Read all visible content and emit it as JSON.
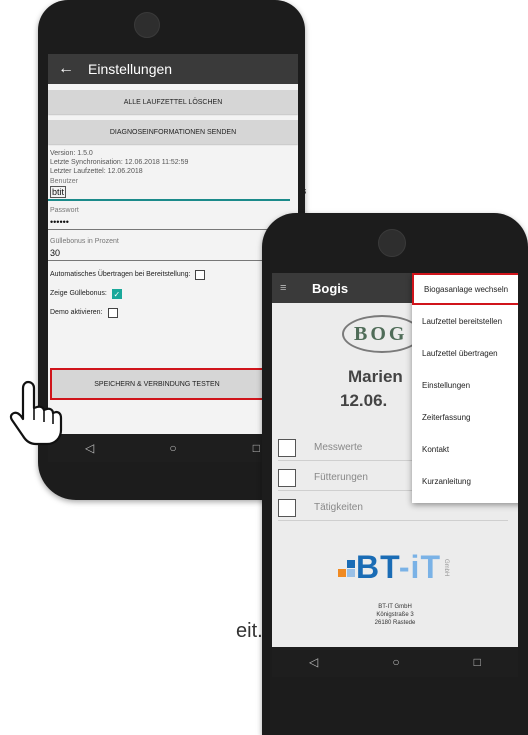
{
  "background_fragments": {
    "quote": "“",
    "tail": "eit."
  },
  "settings_screen": {
    "title": "Einstellungen",
    "btn_delete_all": "ALLE LAUFZETTEL LÖSCHEN",
    "btn_send_diag": "DIAGNOSEINFORMATIONEN SENDEN",
    "info_version": "Version: 1.5.0",
    "info_last_sync": "Letzte Synchronisation: 12.06.2018 11:52:59",
    "info_last_slip": "Letzter Laufzettel: 12.06.2018",
    "user_label": "Benutzer",
    "user_value": "btit",
    "password_label": "Passwort",
    "password_value": "••••••",
    "bonus_label": "Güllebonus in Prozent",
    "bonus_value": "30",
    "auto_transfer_label": "Automatisches Übertragen bei Bereitstellung:",
    "auto_transfer_checked": false,
    "show_bonus_label": "Zeige Güllebonus:",
    "show_bonus_checked": true,
    "demo_label": "Demo aktivieren:",
    "demo_checked": false,
    "save_button": "SPEICHERN & VERBINDUNG TESTEN",
    "accent_color": "#d0141b"
  },
  "home_screen": {
    "title": "Bogis",
    "logo_text": "BOG",
    "site_name": "Marien",
    "site_date": "12.06.",
    "rows": [
      {
        "label": "Messwerte"
      },
      {
        "label": "Fütterungen"
      },
      {
        "label": "Tätigkeiten"
      }
    ],
    "company_logo": {
      "left": "BT",
      "sep": "-",
      "right": "iT",
      "suffix": "GmbH"
    },
    "company_name": "BT-IT GmbH",
    "company_street": "Königstraße 3",
    "company_city": "26180 Rastede"
  },
  "overflow_menu": {
    "items": [
      {
        "label": "Biogasanlage wechseln",
        "highlighted": true
      },
      {
        "label": "Laufzettel bereitstellen"
      },
      {
        "label": "Laufzettel übertragen"
      },
      {
        "label": "Einstellungen"
      },
      {
        "label": "Zeiterfassung"
      },
      {
        "label": "Kontakt"
      },
      {
        "label": "Kurzanleitung"
      }
    ]
  },
  "nav_icons": {
    "back": "◁",
    "home": "○",
    "recent": "□"
  }
}
